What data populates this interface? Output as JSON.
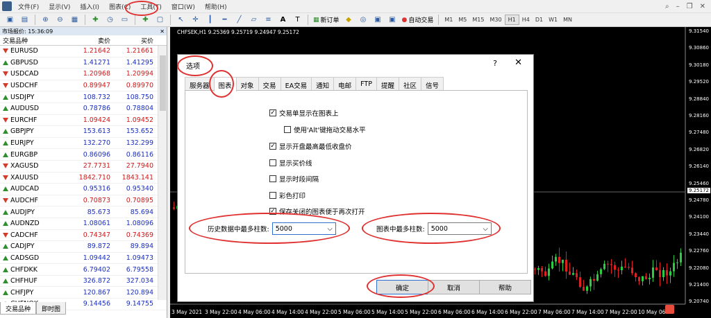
{
  "menubar": {
    "items": [
      "文件(F)",
      "显示(V)",
      "插入(I)",
      "图表(C)",
      "工具(T)",
      "窗口(W)",
      "帮助(H)"
    ]
  },
  "toolbar": {
    "new_order": "新订单",
    "auto_trading": "自动交易",
    "timeframes": [
      "M1",
      "M5",
      "M15",
      "M30",
      "H1",
      "H4",
      "D1",
      "W1",
      "MN"
    ],
    "active_timeframe": "H1"
  },
  "market_watch": {
    "title": "市场报价: 15:36:09",
    "col_symbol": "交易品种",
    "col_bid": "卖价",
    "col_ask": "买价",
    "rows": [
      {
        "symbol": "EURUSD",
        "bid": "1.21642",
        "ask": "1.21661",
        "dir": "dn",
        "color": "red"
      },
      {
        "symbol": "GBPUSD",
        "bid": "1.41271",
        "ask": "1.41295",
        "dir": "up",
        "color": "blue"
      },
      {
        "symbol": "USDCAD",
        "bid": "1.20968",
        "ask": "1.20994",
        "dir": "dn",
        "color": "red"
      },
      {
        "symbol": "USDCHF",
        "bid": "0.89947",
        "ask": "0.89970",
        "dir": "dn",
        "color": "red"
      },
      {
        "symbol": "USDJPY",
        "bid": "108.732",
        "ask": "108.750",
        "dir": "up",
        "color": "blue"
      },
      {
        "symbol": "AUDUSD",
        "bid": "0.78786",
        "ask": "0.78804",
        "dir": "up",
        "color": "blue"
      },
      {
        "symbol": "EURCHF",
        "bid": "1.09424",
        "ask": "1.09452",
        "dir": "dn",
        "color": "red"
      },
      {
        "symbol": "GBPJPY",
        "bid": "153.613",
        "ask": "153.652",
        "dir": "up",
        "color": "blue"
      },
      {
        "symbol": "EURJPY",
        "bid": "132.270",
        "ask": "132.299",
        "dir": "up",
        "color": "blue"
      },
      {
        "symbol": "EURGBP",
        "bid": "0.86096",
        "ask": "0.86116",
        "dir": "up",
        "color": "blue"
      },
      {
        "symbol": "XAGUSD",
        "bid": "27.7731",
        "ask": "27.7940",
        "dir": "dn",
        "color": "red"
      },
      {
        "symbol": "XAUUSD",
        "bid": "1842.710",
        "ask": "1843.141",
        "dir": "dn",
        "color": "red"
      },
      {
        "symbol": "AUDCAD",
        "bid": "0.95316",
        "ask": "0.95340",
        "dir": "up",
        "color": "blue"
      },
      {
        "symbol": "AUDCHF",
        "bid": "0.70873",
        "ask": "0.70895",
        "dir": "dn",
        "color": "red"
      },
      {
        "symbol": "AUDJPY",
        "bid": "85.673",
        "ask": "85.694",
        "dir": "up",
        "color": "blue"
      },
      {
        "symbol": "AUDNZD",
        "bid": "1.08061",
        "ask": "1.08096",
        "dir": "up",
        "color": "blue"
      },
      {
        "symbol": "CADCHF",
        "bid": "0.74347",
        "ask": "0.74369",
        "dir": "dn",
        "color": "red"
      },
      {
        "symbol": "CADJPY",
        "bid": "89.872",
        "ask": "89.894",
        "dir": "up",
        "color": "blue"
      },
      {
        "symbol": "CADSGD",
        "bid": "1.09442",
        "ask": "1.09473",
        "dir": "up",
        "color": "blue"
      },
      {
        "symbol": "CHFDKK",
        "bid": "6.79402",
        "ask": "6.79558",
        "dir": "up",
        "color": "blue"
      },
      {
        "symbol": "CHFHUF",
        "bid": "326.872",
        "ask": "327.034",
        "dir": "up",
        "color": "blue"
      },
      {
        "symbol": "CHFJPY",
        "bid": "120.867",
        "ask": "120.894",
        "dir": "up",
        "color": "blue"
      },
      {
        "symbol": "CHFNOK",
        "bid": "9.14456",
        "ask": "9.14755",
        "dir": "up",
        "color": "blue"
      }
    ],
    "tabs": [
      "交易品种",
      "即时图"
    ]
  },
  "chart": {
    "title": "CHFSEK,H1  9.25369 9.25719 9.24947 9.25172",
    "current_price": "9.25172",
    "price_labels": [
      "9.31540",
      "9.30860",
      "9.30180",
      "9.29520",
      "9.28840",
      "9.28160",
      "9.27480",
      "9.26820",
      "9.26140",
      "9.25460",
      "9.24780",
      "9.24100",
      "9.23440",
      "9.22760",
      "9.22080",
      "9.21400",
      "9.20740"
    ],
    "time_labels": [
      "3 May 2021",
      "3 May 22:00",
      "4 May 06:00",
      "4 May 14:00",
      "4 May 22:00",
      "5 May 06:00",
      "5 May 14:00",
      "5 May 22:00",
      "6 May 06:00",
      "6 May 14:00",
      "6 May 22:00",
      "7 May 06:00",
      "7 May 14:00",
      "7 May 22:00",
      "10 May 06:00"
    ],
    "bull_color": "#2ecc40",
    "bear_color": "#e02020"
  },
  "dialog": {
    "title": "选项",
    "help": "?",
    "close": "✕",
    "tabs": [
      "服务器",
      "图表",
      "对象",
      "交易",
      "EA交易",
      "通知",
      "电邮",
      "FTP",
      "提醒",
      "社区",
      "信号"
    ],
    "active_tab": "图表",
    "checkboxes": [
      {
        "label": "交易单显示在图表上",
        "checked": true
      },
      {
        "label": "使用'Alt'键拖动交易水平",
        "checked": false
      },
      {
        "label": "显示开盘最高最低收盘价",
        "checked": true
      },
      {
        "label": "显示买价线",
        "checked": false
      },
      {
        "label": "显示时段间隔",
        "checked": false
      },
      {
        "label": "彩色打印",
        "checked": false
      },
      {
        "label": "保存关闭的图表便于再次打开",
        "checked": true
      }
    ],
    "history_bars_label": "历史数据中最多柱数:",
    "history_bars_value": "5000",
    "chart_bars_label": "图表中最多柱数:",
    "chart_bars_value": "5000",
    "ok": "确定",
    "cancel": "取消",
    "help_btn": "帮助"
  },
  "annotation_color": "#e03030"
}
